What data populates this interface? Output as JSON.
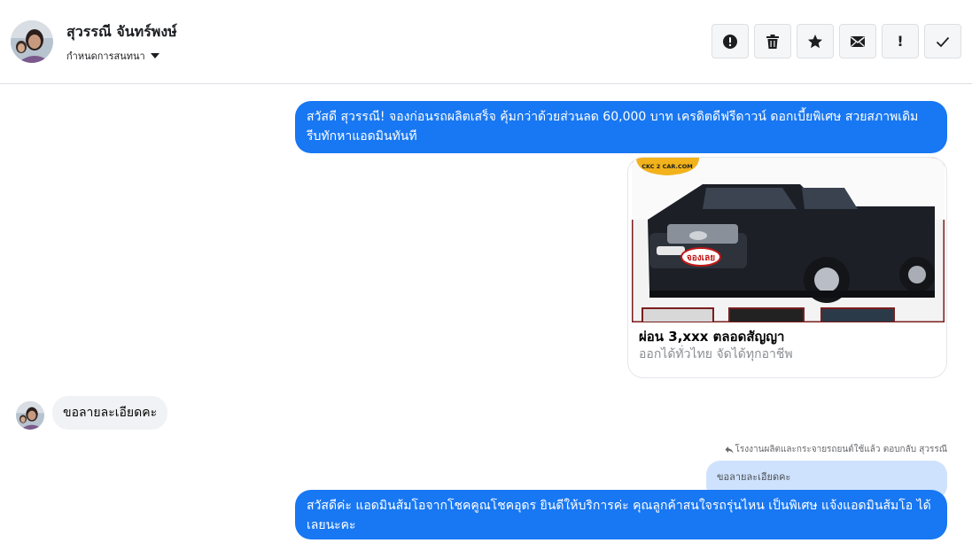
{
  "header": {
    "name": "สุวรรณี จันทร์พงษ์",
    "subtitle": "กำหนดการสนทนา",
    "actions": [
      {
        "name": "alert-button",
        "icon": "alert-circle-icon"
      },
      {
        "name": "delete-button",
        "icon": "trash-icon"
      },
      {
        "name": "star-button",
        "icon": "star-icon"
      },
      {
        "name": "mail-button",
        "icon": "envelope-icon"
      },
      {
        "name": "follow-up-button",
        "icon": "exclamation-icon"
      },
      {
        "name": "done-button",
        "icon": "check-icon"
      }
    ]
  },
  "messages": {
    "outgoing_1": "สวัสดี สุวรรณี! จองก่อนรถผลิตเสร็จ คุ้มกว่าด้วยส่วนลด 60,000 บาท เครดิตดีฟรีดาวน์ ดอกเบี้ยพิเศษ สวยสภาพเดิม รีบทักหาแอดมินทันที",
    "card": {
      "title": "ผ่อน 3,xxx ตลอดสัญญา",
      "subtitle": "ออกได้ทั่วไทย จัดได้ทุกอาชีพ",
      "image_logo_text": "CKC 2 CAR.COM",
      "image_badge_text": "จองเลย"
    },
    "incoming_1": "ขอลายละเอียดคะ",
    "reply_note": "โรงงานผลิตและกระจายรถยนต์ใช้แล้ว ตอบกลับ สุวรรณี",
    "quoted_text": "ขอลายละเอียดคะ",
    "outgoing_2": "สวัสดีค่ะ แอดมินส้มโอจากโชคคูณโชคอุดร ยินดีให้บริการค่ะ   คุณลูกค้าสนใจรถรุ่นไหน เป็นพิเศษ แจ้งแอดมินส้มโอ ได้เลยนะคะ"
  },
  "colors": {
    "outgoing_bubble": "#1877f2",
    "incoming_bubble": "#f0f2f5",
    "quoted_bubble": "#cfe2fd"
  }
}
